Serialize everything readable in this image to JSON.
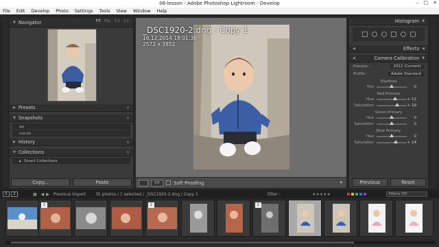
{
  "window": {
    "title": "06-lesson - Adobe Photoshop Lightroom - Develop",
    "controls": [
      "–",
      "□",
      "✕"
    ]
  },
  "menu": [
    "File",
    "Edit",
    "Develop",
    "Photo",
    "Settings",
    "Tools",
    "View",
    "Window",
    "Help"
  ],
  "left": {
    "navigator": {
      "label": "Navigator",
      "zoom": [
        "FIT",
        "FILL",
        "1:1",
        "2:1"
      ]
    },
    "presets": {
      "label": "Presets",
      "action": "+"
    },
    "snapshots": {
      "label": "Snapshots",
      "action": "+",
      "items": [
        "до",
        "после"
      ]
    },
    "history": {
      "label": "History",
      "action": "×"
    },
    "collections": {
      "label": "Collections",
      "action": "+",
      "items": [
        "Smart Collections"
      ]
    },
    "copy_label": "Copy...",
    "paste_label": "Paste"
  },
  "photo_info": {
    "filename": "_DSC1920-2.dng : Copy 1",
    "datetime": "16.12.2014 18:01:36",
    "dimensions": "2572 x 3852"
  },
  "toolbar": {
    "soft_proofing": "Soft Proofing",
    "view_mode": "Y|Y"
  },
  "right": {
    "histogram": {
      "label": "Histogram"
    },
    "effects": {
      "label": "Effects"
    },
    "camera_calibration": {
      "label": "Camera Calibration",
      "process_label": "Process :",
      "process_value": "2012 (Current)",
      "profile_label": "Profile :",
      "profile_value": "Adobe Standard",
      "groups": [
        {
          "name": "Shadows",
          "sliders": [
            {
              "label": "Tint",
              "value": "0",
              "pos": 0.5
            }
          ]
        },
        {
          "name": "Red Primary",
          "sliders": [
            {
              "label": "Hue",
              "value": "+ 12",
              "pos": 0.62
            },
            {
              "label": "Saturation",
              "value": "+ 19",
              "pos": 0.69
            }
          ]
        },
        {
          "name": "Green Primary",
          "sliders": [
            {
              "label": "Hue",
              "value": "0",
              "pos": 0.5
            },
            {
              "label": "Saturation",
              "value": "0",
              "pos": 0.5
            }
          ]
        },
        {
          "name": "Blue Primary",
          "sliders": [
            {
              "label": "Hue",
              "value": "0",
              "pos": 0.5
            },
            {
              "label": "Saturation",
              "value": "+ 14",
              "pos": 0.64
            }
          ]
        }
      ]
    },
    "previous_label": "Previous",
    "reset_label": "Reset"
  },
  "filmstrip": {
    "pages": [
      "1",
      "2"
    ],
    "source": "Previous Import",
    "count": "35 photos / 1 selected / _DSC1920-2.dng / Copy 1",
    "filter_label": "Filter :",
    "filters_off": "Filters Off",
    "badges": [
      "2",
      "2",
      "2"
    ]
  },
  "colors": {
    "accent": "#9a9a9a",
    "panel": "#3a3a3a",
    "canvas": "#6e6e6e",
    "filmstrip_selected": "#a8a8a8"
  }
}
